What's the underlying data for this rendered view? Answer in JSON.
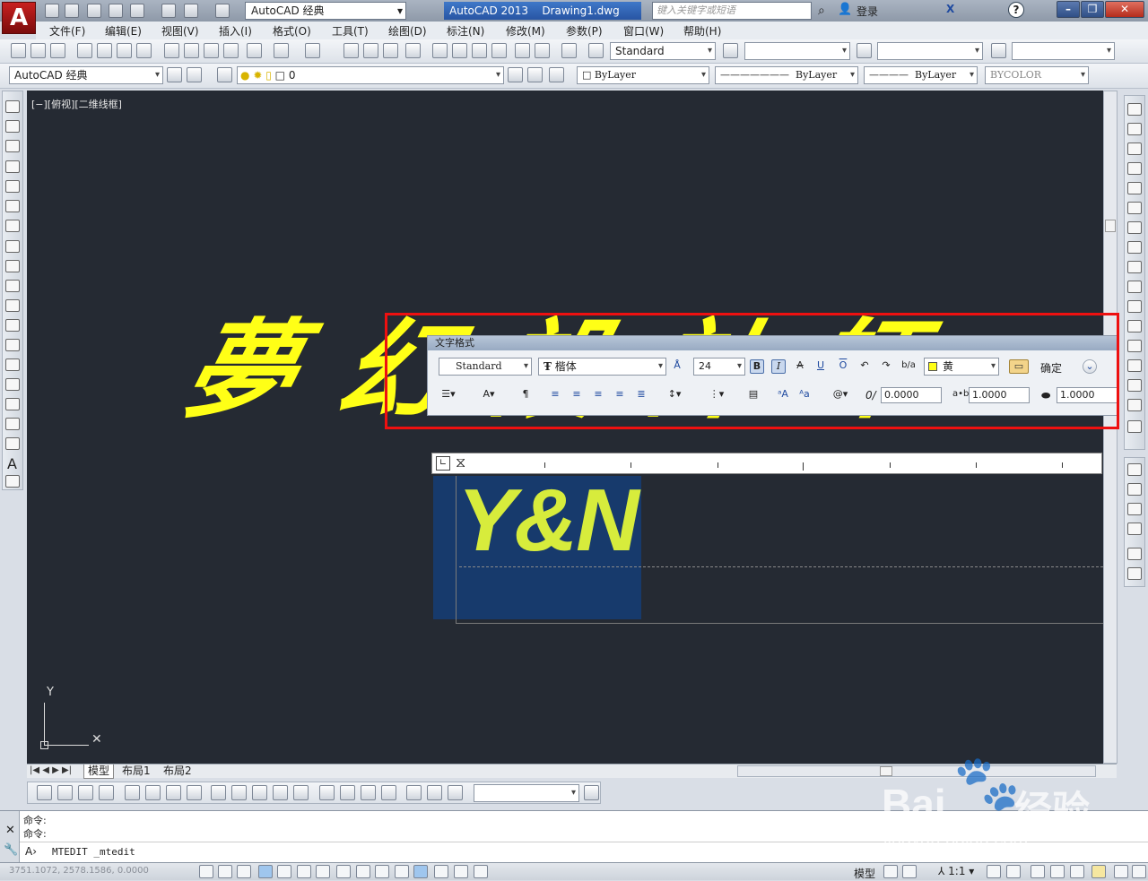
{
  "app": {
    "workspace": "AutoCAD 经典",
    "title_app": "AutoCAD 2013",
    "title_doc": "Drawing1.dwg",
    "search_placeholder": "键入关键字或短语",
    "login": "登录",
    "help": "?"
  },
  "menus": [
    "文件(F)",
    "编辑(E)",
    "视图(V)",
    "插入(I)",
    "格式(O)",
    "工具(T)",
    "绘图(D)",
    "标注(N)",
    "修改(M)",
    "参数(P)",
    "窗口(W)",
    "帮助(H)"
  ],
  "toolbar": {
    "text_style": "Standard",
    "workspace2": "AutoCAD 经典",
    "layer": "0",
    "color": "ByLayer",
    "linetype": "ByLayer",
    "lineweight": "ByLayer",
    "plotstyle": "BYCOLOR"
  },
  "viewport": {
    "label": "[−][俯视][二维线框]",
    "big_text": "夢幻設計師",
    "mtext": "Y&N",
    "ucs_y": "Y"
  },
  "text_format": {
    "title": "文字格式",
    "style": "Standard",
    "font": "楷体",
    "height": "24",
    "color": "黄",
    "ok": "确定",
    "bold": "B",
    "italic": "I",
    "underline": "U",
    "overline": "O",
    "oblique": "0.0000",
    "tracking": "1.0000",
    "width": "1.0000"
  },
  "tabs": [
    "模型",
    "布局1",
    "布局2"
  ],
  "command": {
    "line1": "命令:",
    "line2": "命令:",
    "prompt": "MTEDIT _mtedit"
  },
  "status": {
    "coords": "3751.1072,  2578.1586,  0.0000",
    "model": "模型",
    "scale": "1:1"
  },
  "watermark": {
    "brand": "Bai",
    "brand2": "经验",
    "url": "jingyan.baidu.com"
  }
}
